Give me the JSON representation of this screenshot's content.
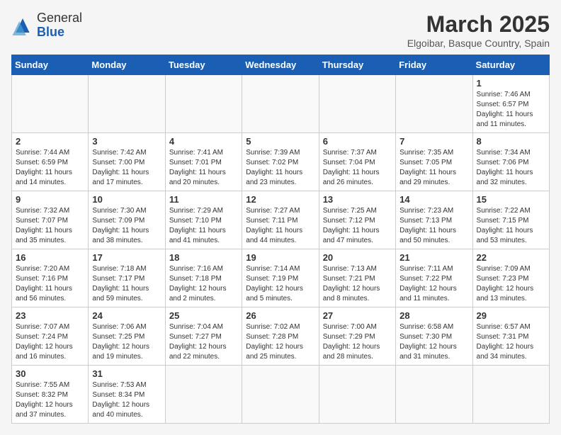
{
  "header": {
    "logo_general": "General",
    "logo_blue": "Blue",
    "month_year": "March 2025",
    "location": "Elgoibar, Basque Country, Spain"
  },
  "weekdays": [
    "Sunday",
    "Monday",
    "Tuesday",
    "Wednesday",
    "Thursday",
    "Friday",
    "Saturday"
  ],
  "weeks": [
    [
      {
        "day": "",
        "info": ""
      },
      {
        "day": "",
        "info": ""
      },
      {
        "day": "",
        "info": ""
      },
      {
        "day": "",
        "info": ""
      },
      {
        "day": "",
        "info": ""
      },
      {
        "day": "",
        "info": ""
      },
      {
        "day": "1",
        "info": "Sunrise: 7:46 AM\nSunset: 6:57 PM\nDaylight: 11 hours\nand 11 minutes."
      }
    ],
    [
      {
        "day": "2",
        "info": "Sunrise: 7:44 AM\nSunset: 6:59 PM\nDaylight: 11 hours\nand 14 minutes."
      },
      {
        "day": "3",
        "info": "Sunrise: 7:42 AM\nSunset: 7:00 PM\nDaylight: 11 hours\nand 17 minutes."
      },
      {
        "day": "4",
        "info": "Sunrise: 7:41 AM\nSunset: 7:01 PM\nDaylight: 11 hours\nand 20 minutes."
      },
      {
        "day": "5",
        "info": "Sunrise: 7:39 AM\nSunset: 7:02 PM\nDaylight: 11 hours\nand 23 minutes."
      },
      {
        "day": "6",
        "info": "Sunrise: 7:37 AM\nSunset: 7:04 PM\nDaylight: 11 hours\nand 26 minutes."
      },
      {
        "day": "7",
        "info": "Sunrise: 7:35 AM\nSunset: 7:05 PM\nDaylight: 11 hours\nand 29 minutes."
      },
      {
        "day": "8",
        "info": "Sunrise: 7:34 AM\nSunset: 7:06 PM\nDaylight: 11 hours\nand 32 minutes."
      }
    ],
    [
      {
        "day": "9",
        "info": "Sunrise: 7:32 AM\nSunset: 7:07 PM\nDaylight: 11 hours\nand 35 minutes."
      },
      {
        "day": "10",
        "info": "Sunrise: 7:30 AM\nSunset: 7:09 PM\nDaylight: 11 hours\nand 38 minutes."
      },
      {
        "day": "11",
        "info": "Sunrise: 7:29 AM\nSunset: 7:10 PM\nDaylight: 11 hours\nand 41 minutes."
      },
      {
        "day": "12",
        "info": "Sunrise: 7:27 AM\nSunset: 7:11 PM\nDaylight: 11 hours\nand 44 minutes."
      },
      {
        "day": "13",
        "info": "Sunrise: 7:25 AM\nSunset: 7:12 PM\nDaylight: 11 hours\nand 47 minutes."
      },
      {
        "day": "14",
        "info": "Sunrise: 7:23 AM\nSunset: 7:13 PM\nDaylight: 11 hours\nand 50 minutes."
      },
      {
        "day": "15",
        "info": "Sunrise: 7:22 AM\nSunset: 7:15 PM\nDaylight: 11 hours\nand 53 minutes."
      }
    ],
    [
      {
        "day": "16",
        "info": "Sunrise: 7:20 AM\nSunset: 7:16 PM\nDaylight: 11 hours\nand 56 minutes."
      },
      {
        "day": "17",
        "info": "Sunrise: 7:18 AM\nSunset: 7:17 PM\nDaylight: 11 hours\nand 59 minutes."
      },
      {
        "day": "18",
        "info": "Sunrise: 7:16 AM\nSunset: 7:18 PM\nDaylight: 12 hours\nand 2 minutes."
      },
      {
        "day": "19",
        "info": "Sunrise: 7:14 AM\nSunset: 7:19 PM\nDaylight: 12 hours\nand 5 minutes."
      },
      {
        "day": "20",
        "info": "Sunrise: 7:13 AM\nSunset: 7:21 PM\nDaylight: 12 hours\nand 8 minutes."
      },
      {
        "day": "21",
        "info": "Sunrise: 7:11 AM\nSunset: 7:22 PM\nDaylight: 12 hours\nand 11 minutes."
      },
      {
        "day": "22",
        "info": "Sunrise: 7:09 AM\nSunset: 7:23 PM\nDaylight: 12 hours\nand 13 minutes."
      }
    ],
    [
      {
        "day": "23",
        "info": "Sunrise: 7:07 AM\nSunset: 7:24 PM\nDaylight: 12 hours\nand 16 minutes."
      },
      {
        "day": "24",
        "info": "Sunrise: 7:06 AM\nSunset: 7:25 PM\nDaylight: 12 hours\nand 19 minutes."
      },
      {
        "day": "25",
        "info": "Sunrise: 7:04 AM\nSunset: 7:27 PM\nDaylight: 12 hours\nand 22 minutes."
      },
      {
        "day": "26",
        "info": "Sunrise: 7:02 AM\nSunset: 7:28 PM\nDaylight: 12 hours\nand 25 minutes."
      },
      {
        "day": "27",
        "info": "Sunrise: 7:00 AM\nSunset: 7:29 PM\nDaylight: 12 hours\nand 28 minutes."
      },
      {
        "day": "28",
        "info": "Sunrise: 6:58 AM\nSunset: 7:30 PM\nDaylight: 12 hours\nand 31 minutes."
      },
      {
        "day": "29",
        "info": "Sunrise: 6:57 AM\nSunset: 7:31 PM\nDaylight: 12 hours\nand 34 minutes."
      }
    ],
    [
      {
        "day": "30",
        "info": "Sunrise: 7:55 AM\nSunset: 8:32 PM\nDaylight: 12 hours\nand 37 minutes."
      },
      {
        "day": "31",
        "info": "Sunrise: 7:53 AM\nSunset: 8:34 PM\nDaylight: 12 hours\nand 40 minutes."
      },
      {
        "day": "",
        "info": ""
      },
      {
        "day": "",
        "info": ""
      },
      {
        "day": "",
        "info": ""
      },
      {
        "day": "",
        "info": ""
      },
      {
        "day": "",
        "info": ""
      }
    ]
  ]
}
